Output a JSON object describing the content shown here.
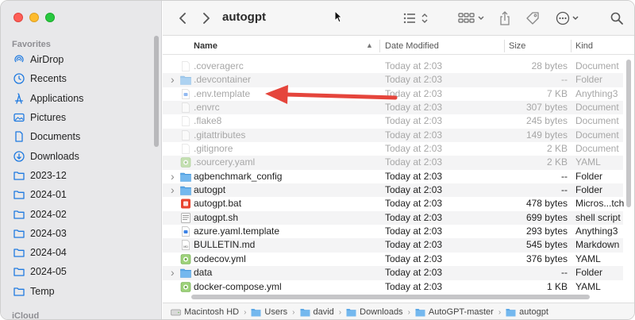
{
  "window": {
    "title": "autogpt"
  },
  "sidebar": {
    "favorites_heading": "Favorites",
    "icloud_heading": "iCloud",
    "items": [
      {
        "label": "AirDrop",
        "icon": "airdrop-icon"
      },
      {
        "label": "Recents",
        "icon": "clock-icon"
      },
      {
        "label": "Applications",
        "icon": "applications-icon"
      },
      {
        "label": "Pictures",
        "icon": "pictures-icon"
      },
      {
        "label": "Documents",
        "icon": "document-icon"
      },
      {
        "label": "Downloads",
        "icon": "download-icon"
      },
      {
        "label": "2023-12",
        "icon": "folder-icon"
      },
      {
        "label": "2024-01",
        "icon": "folder-icon"
      },
      {
        "label": "2024-02",
        "icon": "folder-icon"
      },
      {
        "label": "2024-03",
        "icon": "folder-icon"
      },
      {
        "label": "2024-04",
        "icon": "folder-icon"
      },
      {
        "label": "2024-05",
        "icon": "folder-icon"
      },
      {
        "label": "Temp",
        "icon": "folder-icon"
      }
    ]
  },
  "columns": {
    "name": "Name",
    "date": "Date Modified",
    "size": "Size",
    "kind": "Kind"
  },
  "files": [
    {
      "name": ".coveragerc",
      "date": "Today at 2:03",
      "size": "28 bytes",
      "kind": "Document",
      "type": "doc",
      "hidden": true,
      "folder": false
    },
    {
      "name": ".devcontainer",
      "date": "Today at 2:03",
      "size": "--",
      "kind": "Folder",
      "type": "folder",
      "hidden": true,
      "folder": true
    },
    {
      "name": ".env.template",
      "date": "Today at 2:03",
      "size": "7 KB",
      "kind": "Anything3",
      "type": "anything",
      "hidden": true,
      "folder": false
    },
    {
      "name": ".envrc",
      "date": "Today at 2:03",
      "size": "307 bytes",
      "kind": "Document",
      "type": "doc",
      "hidden": true,
      "folder": false
    },
    {
      "name": ".flake8",
      "date": "Today at 2:03",
      "size": "245 bytes",
      "kind": "Document",
      "type": "doc",
      "hidden": true,
      "folder": false
    },
    {
      "name": ".gitattributes",
      "date": "Today at 2:03",
      "size": "149 bytes",
      "kind": "Document",
      "type": "doc",
      "hidden": true,
      "folder": false
    },
    {
      "name": ".gitignore",
      "date": "Today at 2:03",
      "size": "2 KB",
      "kind": "Document",
      "type": "doc",
      "hidden": true,
      "folder": false
    },
    {
      "name": ".sourcery.yaml",
      "date": "Today at 2:03",
      "size": "2 KB",
      "kind": "YAML",
      "type": "yaml",
      "hidden": true,
      "folder": false
    },
    {
      "name": "agbenchmark_config",
      "date": "Today at 2:03",
      "size": "--",
      "kind": "Folder",
      "type": "folder",
      "hidden": false,
      "folder": true
    },
    {
      "name": "autogpt",
      "date": "Today at 2:03",
      "size": "--",
      "kind": "Folder",
      "type": "folder",
      "hidden": false,
      "folder": true
    },
    {
      "name": "autogpt.bat",
      "date": "Today at 2:03",
      "size": "478 bytes",
      "kind": "Micros...tch",
      "type": "bat",
      "hidden": false,
      "folder": false
    },
    {
      "name": "autogpt.sh",
      "date": "Today at 2:03",
      "size": "699 bytes",
      "kind": "shell script",
      "type": "sh",
      "hidden": false,
      "folder": false
    },
    {
      "name": "azure.yaml.template",
      "date": "Today at 2:03",
      "size": "293 bytes",
      "kind": "Anything3",
      "type": "anything",
      "hidden": false,
      "folder": false
    },
    {
      "name": "BULLETIN.md",
      "date": "Today at 2:03",
      "size": "545 bytes",
      "kind": "Markdown",
      "type": "md",
      "hidden": false,
      "folder": false
    },
    {
      "name": "codecov.yml",
      "date": "Today at 2:03",
      "size": "376 bytes",
      "kind": "YAML",
      "type": "yaml",
      "hidden": false,
      "folder": false
    },
    {
      "name": "data",
      "date": "Today at 2:03",
      "size": "--",
      "kind": "Folder",
      "type": "folder",
      "hidden": false,
      "folder": true
    },
    {
      "name": "docker-compose.yml",
      "date": "Today at 2:03",
      "size": "1 KB",
      "kind": "YAML",
      "type": "yaml",
      "hidden": false,
      "folder": false
    }
  ],
  "pathbar": [
    {
      "label": "Macintosh HD",
      "icon": "hard-drive-icon"
    },
    {
      "label": "Users",
      "icon": "folder-icon"
    },
    {
      "label": "david",
      "icon": "folder-icon"
    },
    {
      "label": "Downloads",
      "icon": "folder-icon"
    },
    {
      "label": "AutoGPT-master",
      "icon": "folder-icon"
    },
    {
      "label": "autogpt",
      "icon": "folder-icon"
    }
  ],
  "colors": {
    "accent": "#1e90ff",
    "folder": "#5aa7e6",
    "annotation_arrow": "#e5453c"
  }
}
